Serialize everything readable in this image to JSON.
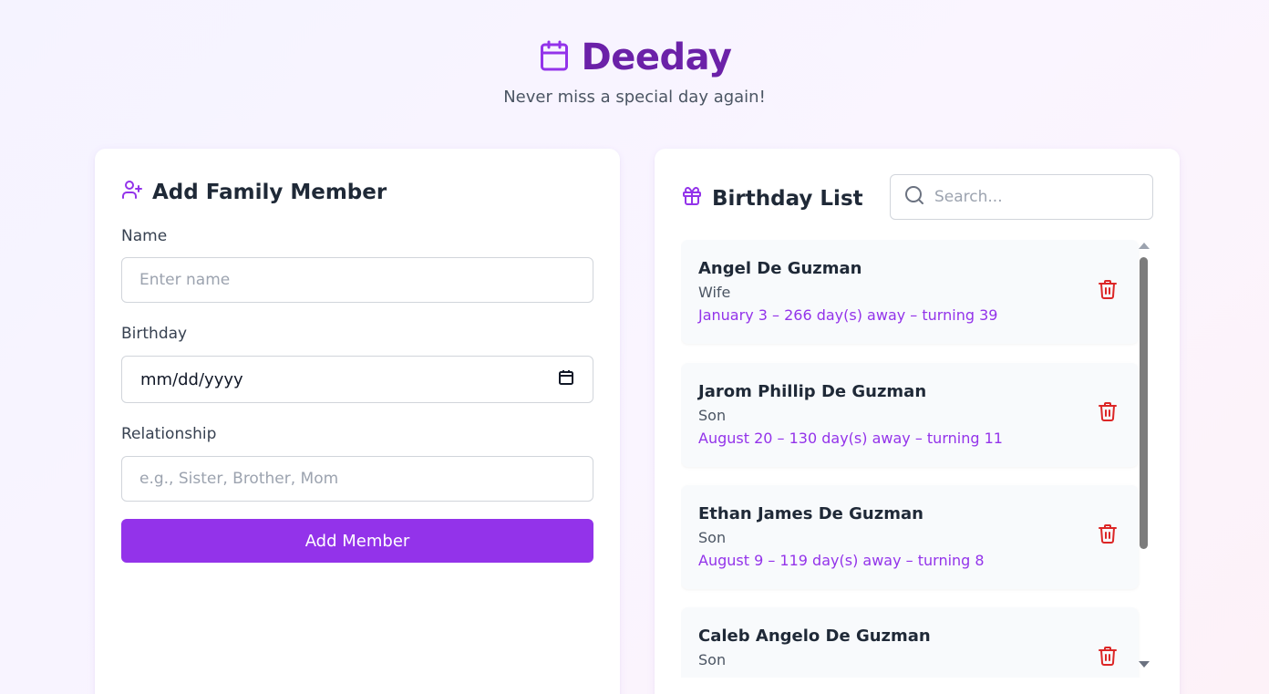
{
  "app": {
    "title": "Deeday",
    "tagline": "Never miss a special day again!"
  },
  "add_form": {
    "heading": "Add Family Member",
    "name_label": "Name",
    "name_placeholder": "Enter name",
    "birthday_label": "Birthday",
    "birthday_value": "mm/dd/yyyy",
    "relationship_label": "Relationship",
    "relationship_placeholder": "e.g., Sister, Brother, Mom",
    "submit_label": "Add Member"
  },
  "birthday_list": {
    "heading": "Birthday List",
    "search_placeholder": "Search...",
    "items": [
      {
        "name": "Angel De Guzman",
        "relationship": "Wife",
        "detail": "January 3 – 266 day(s) away – turning 39"
      },
      {
        "name": "Jarom Phillip De Guzman",
        "relationship": "Son",
        "detail": "August 20 – 130 day(s) away – turning 11"
      },
      {
        "name": "Ethan James De Guzman",
        "relationship": "Son",
        "detail": "August 9 – 119 day(s) away – turning 8"
      },
      {
        "name": "Caleb Angelo De Guzman",
        "relationship": "Son",
        "detail": ""
      }
    ]
  },
  "icons": {
    "brand": "calendar-icon",
    "add_form": "user-plus-icon",
    "list": "gift-icon",
    "search": "search-icon",
    "delete": "trash-icon",
    "date_picker": "calendar-icon"
  },
  "colors": {
    "brand": "#6b21a8",
    "accent": "#9333ea",
    "delete": "#dc2626"
  }
}
